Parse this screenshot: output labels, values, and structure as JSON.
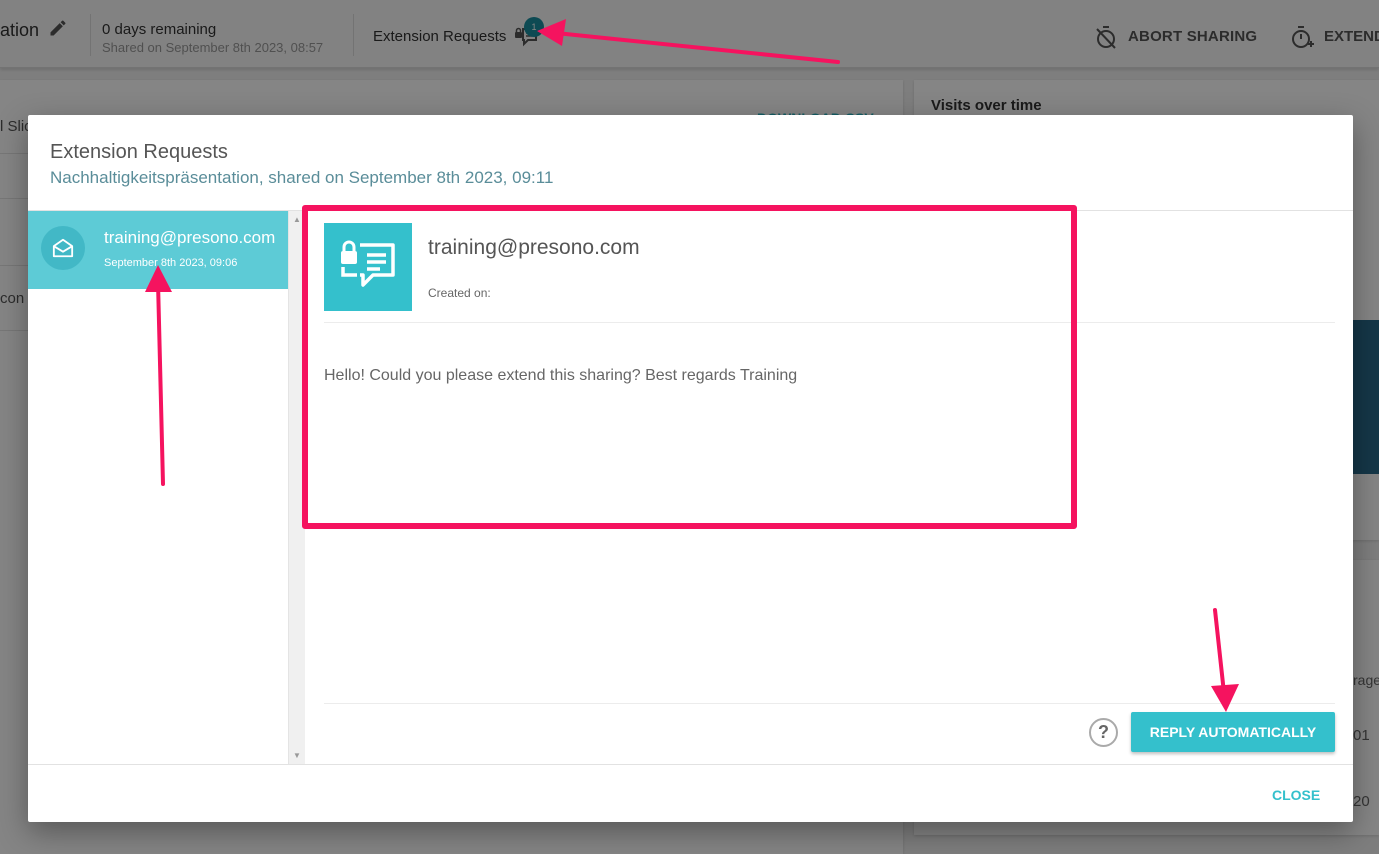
{
  "header": {
    "title_fragment": "ation",
    "days_remaining": "0 days remaining",
    "shared_on": "Shared on September 8th 2023, 08:57",
    "extension_requests_label": "Extension Requests",
    "extension_requests_count": "1",
    "abort_label": "ABORT SHARING",
    "extend_label": "EXTEND"
  },
  "background": {
    "download_csv": "DOWNLOAD CSV",
    "slides_fragment": "l Slic",
    "con_fragment": "con",
    "visits_title": "Visits over time",
    "rage_fragment": "rage",
    "num1_fragment": "01",
    "num2_fragment": "20"
  },
  "dialog": {
    "title": "Extension Requests",
    "subtitle": "Nachhaltigkeitspräsentation, shared on September 8th 2023, 09:11",
    "requests": [
      {
        "email": "training@presono.com",
        "date": "September 8th 2023, 09:06"
      }
    ],
    "detail": {
      "email": "training@presono.com",
      "created_label": "Created on:",
      "message": "Hello! Could you please extend this sharing? Best regards Training"
    },
    "help_label": "?",
    "reply_label": "REPLY AUTOMATICALLY",
    "close_label": "CLOSE"
  },
  "colors": {
    "accent": "#34c0cc",
    "selected_item": "#5dcbd6",
    "annotation": "#f5135f"
  },
  "icons": {
    "edit": "pencil-icon",
    "extension": "chat-lock-icon",
    "abort": "timer-off-icon",
    "extend": "timer-plus-icon",
    "request": "envelope-open-icon"
  }
}
